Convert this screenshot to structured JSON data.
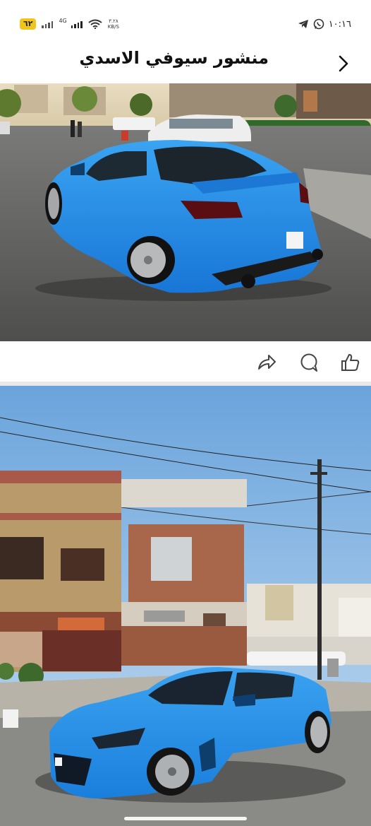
{
  "status_bar": {
    "battery": "٦٢",
    "network": "4G",
    "speed": "٣.٢٨",
    "speed_unit": "KB/S",
    "time": "١٠:١٦"
  },
  "header": {
    "title": "منشور سيوفي الاسدي",
    "back_icon": "chevron-right-icon"
  },
  "posts": [
    {
      "image": "blue sports car rear three-quarter view on residential street"
    },
    {
      "image": "blue sports car front three-quarter view in front of houses"
    }
  ],
  "actions": {
    "share_icon": "share-icon",
    "comment_icon": "comment-icon",
    "like_icon": "thumbs-up-icon"
  },
  "colors": {
    "car_blue": "#1f8ee8",
    "battery": "#f0c51c"
  }
}
